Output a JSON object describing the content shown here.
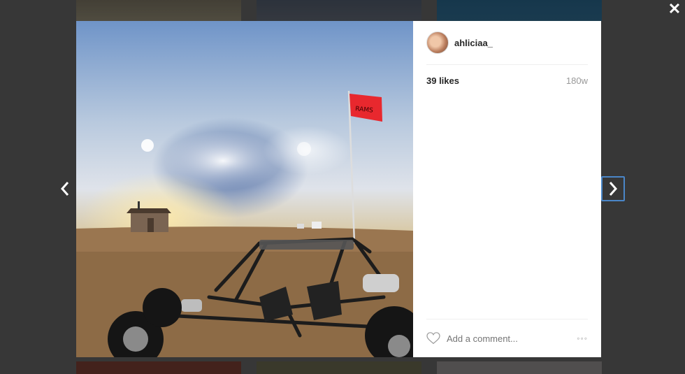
{
  "post": {
    "username": "ahliciaa_",
    "likes": "39 likes",
    "age": "180w",
    "comment_placeholder": "Add a comment...",
    "more_label": "◦◦◦"
  },
  "controls": {
    "close_label": "✕"
  },
  "icons": {
    "close": "close-icon",
    "prev": "chevron-left-icon",
    "next": "chevron-right-icon",
    "like": "heart-icon",
    "more": "more-options-icon"
  },
  "colors": {
    "backdrop": "#4a4a4a",
    "focus_ring": "#4a86c8",
    "flag": "#e8282e"
  }
}
